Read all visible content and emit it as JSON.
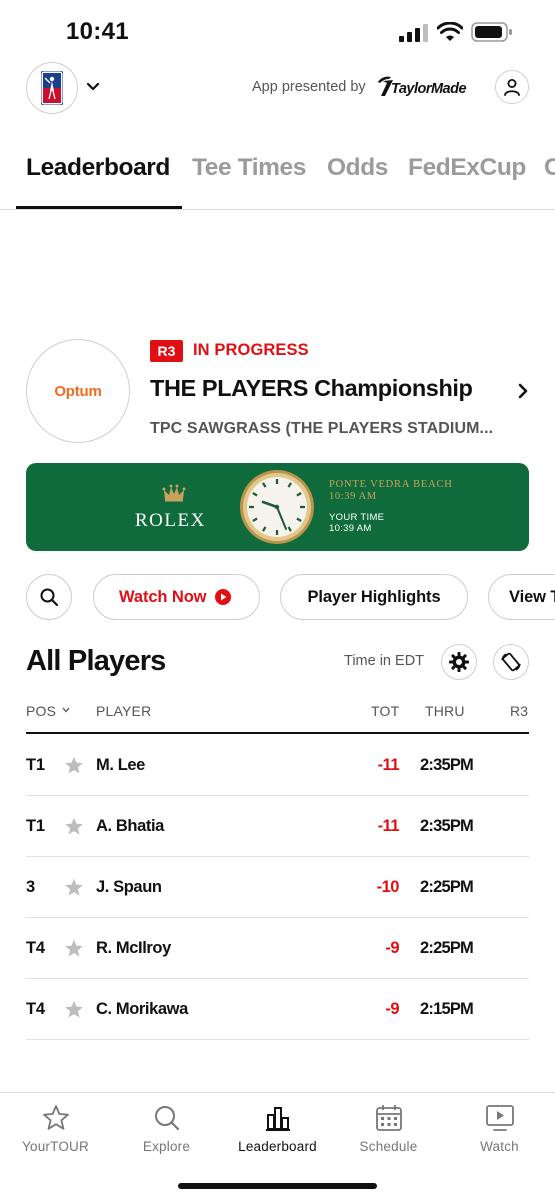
{
  "status_bar": {
    "time": "10:41"
  },
  "header": {
    "presented_by": "App presented by",
    "sponsor_brand": "TaylorMade"
  },
  "tabs": [
    {
      "label": "Leaderboard",
      "active": true
    },
    {
      "label": "Tee Times",
      "active": false
    },
    {
      "label": "Odds",
      "active": false
    },
    {
      "label": "FedExCup",
      "active": false
    },
    {
      "label": "C",
      "active": false
    }
  ],
  "tournament": {
    "sponsor": "Optum",
    "round": "R3",
    "status": "IN PROGRESS",
    "name": "THE PLAYERS Championship",
    "venue": "TPC SAWGRASS (THE PLAYERS STADIUM..."
  },
  "rolex_banner": {
    "brand": "ROLEX",
    "location": "PONTE VEDRA BEACH",
    "local_time": "10:39 AM",
    "your_time_label": "YOUR TIME",
    "your_time": "10:39 AM"
  },
  "actions": {
    "watch_now": "Watch Now",
    "player_highlights": "Player Highlights",
    "view": "View T"
  },
  "leaderboard": {
    "title": "All Players",
    "timezone_label": "Time in EDT",
    "columns": {
      "pos": "POS",
      "player": "PLAYER",
      "tot": "TOT",
      "thru": "THRU",
      "round": "R3"
    },
    "rows": [
      {
        "pos": "T1",
        "player": "M. Lee",
        "tot": "-11",
        "thru": "2:35PM"
      },
      {
        "pos": "T1",
        "player": "A. Bhatia",
        "tot": "-11",
        "thru": "2:35PM"
      },
      {
        "pos": "3",
        "player": "J. Spaun",
        "tot": "-10",
        "thru": "2:25PM"
      },
      {
        "pos": "T4",
        "player": "R. McIlroy",
        "tot": "-9",
        "thru": "2:25PM"
      },
      {
        "pos": "T4",
        "player": "C. Morikawa",
        "tot": "-9",
        "thru": "2:15PM"
      }
    ]
  },
  "bottom_nav": [
    {
      "label": "YourTOUR",
      "icon": "star-icon",
      "active": false
    },
    {
      "label": "Explore",
      "icon": "search-icon",
      "active": false
    },
    {
      "label": "Leaderboard",
      "icon": "bar-chart-icon",
      "active": true
    },
    {
      "label": "Schedule",
      "icon": "calendar-icon",
      "active": false
    },
    {
      "label": "Watch",
      "icon": "play-screen-icon",
      "active": false
    }
  ],
  "colors": {
    "accent_red": "#e10f14",
    "rolex_green": "#0f6b3b",
    "rolex_gold": "#c9a25b",
    "optum_orange": "#f26a21"
  }
}
